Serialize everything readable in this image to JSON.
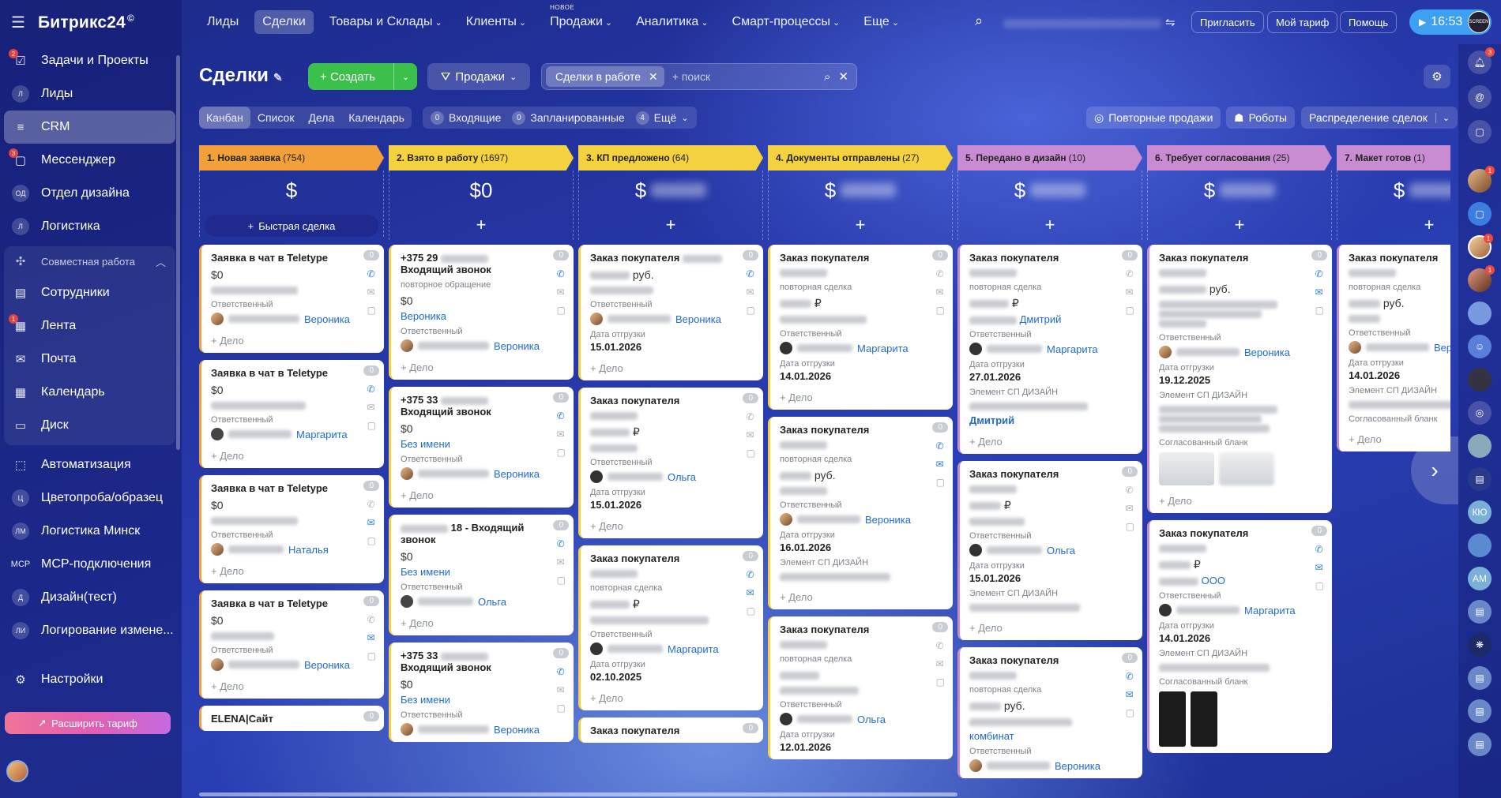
{
  "app": {
    "logo": "Битрикс24",
    "logo_mark": "©"
  },
  "sidebar": {
    "items": [
      {
        "label": "Задачи и Проекты",
        "badge": "2",
        "icon": "checklist-icon"
      },
      {
        "label": "Лиды",
        "abbr": "Л"
      },
      {
        "label": "CRM",
        "icon": "crm-funnel-icon"
      },
      {
        "label": "Мессенджер",
        "badge": "3",
        "icon": "chat-icon"
      },
      {
        "label": "Отдел дизайна",
        "abbr": "ОД"
      },
      {
        "label": "Логистика",
        "abbr": "Л"
      }
    ],
    "group_title": "Совместная работа",
    "group_items": [
      {
        "label": "Сотрудники",
        "icon": "employees-icon"
      },
      {
        "label": "Лента",
        "badge": "1",
        "icon": "feed-icon"
      },
      {
        "label": "Почта",
        "icon": "mail-icon"
      },
      {
        "label": "Календарь",
        "icon": "calendar-icon"
      },
      {
        "label": "Диск",
        "icon": "disk-icon"
      }
    ],
    "items2": [
      {
        "label": "Автоматизация",
        "icon": "automation-icon"
      },
      {
        "label": "Цветопроба/образец",
        "abbr": "Ц"
      },
      {
        "label": "Логистика Минск",
        "abbr": "ЛМ"
      },
      {
        "label": "МСР-подключения",
        "abbr": "МСР"
      },
      {
        "label": "Дизайн(тест)",
        "abbr": "Д"
      },
      {
        "label": "Логирование измене...",
        "abbr": "ЛИ"
      }
    ],
    "settings": "Настройки",
    "upgrade": "Расширить тариф"
  },
  "topnav": {
    "items": [
      "Лиды",
      "Сделки",
      "Товары и Склады",
      "Клиенты",
      "Продажи",
      "Аналитика",
      "Смарт-процессы",
      "Еще"
    ],
    "new_tag": "НОВОЕ",
    "invite": "Пригласить",
    "my_plan": "Мой тариф",
    "help": "Помощь",
    "time": "16:53",
    "user": "SCREEN"
  },
  "toolbar": {
    "title": "Сделки",
    "create": "Создать",
    "category": "Продажи",
    "filter_chip": "Сделки в работе",
    "search_placeholder": "+ поиск"
  },
  "views": [
    "Канбан",
    "Список",
    "Дела",
    "Календарь"
  ],
  "counters": {
    "incoming": {
      "n": "0",
      "label": "Входящие"
    },
    "planned": {
      "n": "0",
      "label": "Запланированные"
    },
    "more": {
      "n": "4",
      "label": "Ещё"
    }
  },
  "right_buttons": {
    "repeat": "Повторные продажи",
    "robots": "Роботы",
    "distribution": "Распределение сделок"
  },
  "kanban": {
    "quick_deal": "Быстрая сделка",
    "responsible_label": "Ответственный",
    "ship_label": "Дата отгрузки",
    "add_activity": "+ Дело",
    "repeat_label": "повторная сделка",
    "repeat_call": "повторное обращение",
    "design_label": "Элемент СП ДИЗАЙН",
    "blank_label": "Согласованный бланк",
    "columns": [
      {
        "title": "1. Новая заявка",
        "count": "(754)",
        "color": "#f2a13a",
        "sum": "$"
      },
      {
        "title": "2. Взято в работу",
        "count": "(1697)",
        "color": "#f4d23f",
        "sum": "$0"
      },
      {
        "title": "3. КП предложено",
        "count": "(64)",
        "color": "#f4d23f",
        "sum": "$"
      },
      {
        "title": "4. Документы отправлены",
        "count": "(27)",
        "color": "#f4d23f",
        "sum": "$"
      },
      {
        "title": "5. Передано в дизайн",
        "count": "(10)",
        "color": "#c98bd2",
        "sum": "$"
      },
      {
        "title": "6. Требует согласования",
        "count": "(25)",
        "color": "#c98bd2",
        "sum": "$"
      },
      {
        "title": "7. Макет готов",
        "count": "(1)",
        "color": "#c98bd2",
        "sum": "$"
      }
    ],
    "cards": {
      "c1": [
        {
          "t": "Заявка в чат в Teletype",
          "amt": "$0",
          "resp": "Вероника"
        },
        {
          "t": "Заявка в чат в Teletype",
          "amt": "$0",
          "resp": "Маргарита"
        },
        {
          "t": "Заявка в чат в Teletype",
          "amt": "$0",
          "resp": "Наталья"
        },
        {
          "t": "Заявка в чат в Teletype",
          "amt": "$0",
          "resp": "Вероника"
        },
        {
          "t": "ELENA|Сайт"
        }
      ],
      "c2": [
        {
          "t": "+375 29",
          "t2": "Входящий звонок",
          "amt": "$0",
          "link": "Вероника",
          "resp": "Вероника"
        },
        {
          "t": "+375 33",
          "t2": "Входящий звонок",
          "amt": "$0",
          "link": "Без имени",
          "resp": "Вероника"
        },
        {
          "t": "18 - Входящий звонок",
          "amt": "$0",
          "link": "Без имени",
          "resp": "Ольга"
        },
        {
          "t": "+375 33",
          "t2": "Входящий звонок",
          "amt": "$0",
          "link": "Без имени",
          "resp": "Вероника"
        }
      ],
      "c3": [
        {
          "t": "Заказ покупателя",
          "cur": "руб.",
          "resp": "Вероника",
          "date": "15.01.2026"
        },
        {
          "t": "Заказ покупателя",
          "cur": "₽",
          "resp": "Ольга",
          "date": "15.01.2026"
        },
        {
          "t": "Заказ покупателя",
          "cur": "₽",
          "resp": "Маргарита",
          "date": "02.10.2025"
        },
        {
          "t": "Заказ покупателя"
        }
      ],
      "c4": [
        {
          "t": "Заказ покупателя",
          "cur": "₽",
          "resp": "Маргарита",
          "date": "14.01.2026"
        },
        {
          "t": "Заказ покупателя",
          "cur": "руб.",
          "resp": "Вероника",
          "date": "16.01.2026"
        },
        {
          "t": "Заказ покупателя",
          "resp": "Ольга",
          "date": "12.01.2026"
        }
      ],
      "c5": [
        {
          "t": "Заказ покупателя",
          "cur": "₽",
          "link": "Дмитрий",
          "resp": "Маргарита",
          "date": "27.01.2026",
          "design": "Дмитрий"
        },
        {
          "t": "Заказ покупателя",
          "cur": "₽",
          "resp": "Ольга",
          "date": "15.01.2026"
        },
        {
          "t": "Заказ покупателя",
          "cur": "руб.",
          "link": "комбинат",
          "resp": "Вероника"
        }
      ],
      "c6": [
        {
          "t": "Заказ покупателя",
          "cur": "руб.",
          "resp": "Вероника",
          "date": "19.12.2025"
        },
        {
          "t": "Заказ покупателя",
          "cur": "₽",
          "link": "ООО",
          "resp": "Маргарита",
          "date": "14.01.2026"
        }
      ],
      "c7": [
        {
          "t": "Заказ покупателя",
          "cur": "руб.",
          "resp": "Веро",
          "date": "14.01.2026"
        }
      ]
    }
  },
  "rightbar": {
    "notif_badge": "3",
    "chat_badge": "1",
    "user_initials": [
      "КЮ",
      "АМ"
    ]
  }
}
